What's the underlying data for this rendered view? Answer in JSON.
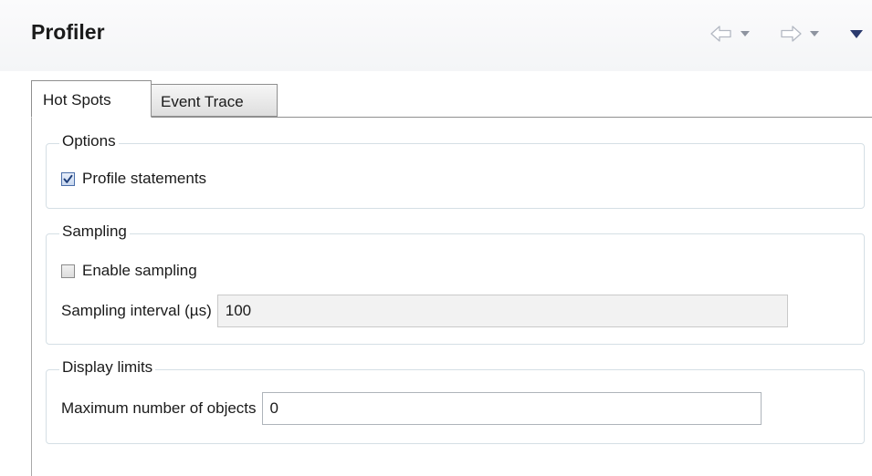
{
  "header": {
    "title": "Profiler",
    "icons": [
      "back-arrow-icon",
      "chevron-down-icon",
      "forward-arrow-icon",
      "chevron-down-icon",
      "view-menu-icon"
    ]
  },
  "tabs": [
    {
      "label": "Hot Spots",
      "active": true
    },
    {
      "label": "Event Trace",
      "active": false
    }
  ],
  "options": {
    "legend": "Options",
    "profile_statements_label": "Profile statements",
    "profile_statements_checked": true
  },
  "sampling": {
    "legend": "Sampling",
    "enable_sampling_label": "Enable sampling",
    "enable_sampling_checked": false,
    "interval_label": "Sampling interval (µs)",
    "interval_value": "100"
  },
  "display_limits": {
    "legend": "Display limits",
    "max_objects_label": "Maximum number of objects",
    "max_objects_value": "0"
  },
  "colors": {
    "accent_check": "#4a6ea9",
    "nav_active": "#2b3a6e",
    "nav_inactive": "#b3b8c2"
  }
}
